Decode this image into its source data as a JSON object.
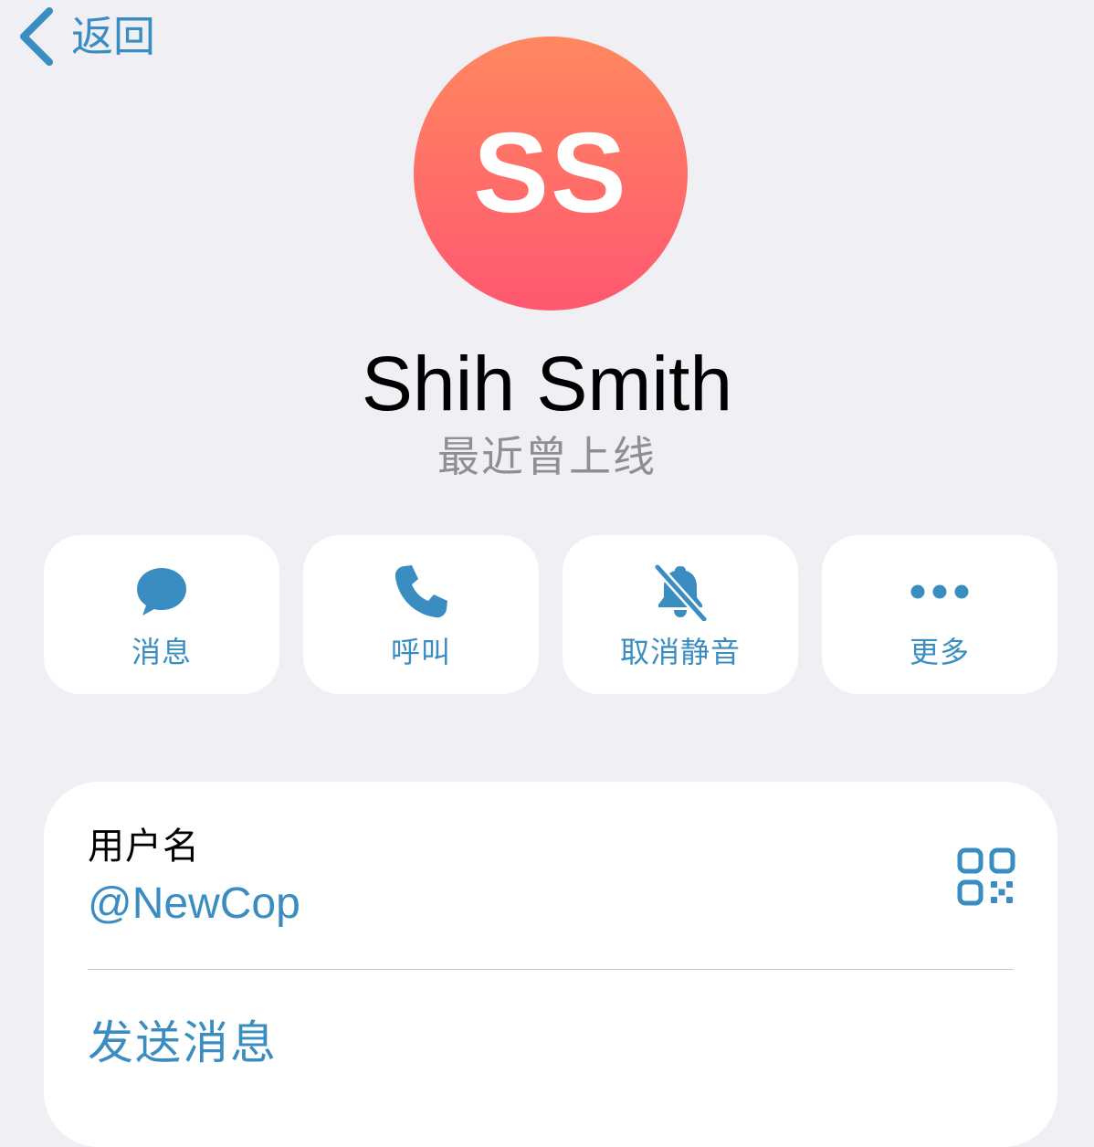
{
  "nav": {
    "back_label": "返回"
  },
  "profile": {
    "initials": "SS",
    "name": "Shih Smith",
    "status": "最近曾上线",
    "avatar_gradient": [
      "#ff875f",
      "#ff5870"
    ]
  },
  "actions": [
    {
      "label": "消息",
      "icon": "message-bubble-icon"
    },
    {
      "label": "呼叫",
      "icon": "phone-icon"
    },
    {
      "label": "取消静音",
      "icon": "bell-slash-icon"
    },
    {
      "label": "更多",
      "icon": "ellipsis-icon"
    }
  ],
  "info": {
    "username_label": "用户名",
    "username_value": "@NewCop",
    "qr_icon": "qr-code-icon",
    "send_message_label": "发送消息"
  },
  "colors": {
    "accent": "#3a8dc0",
    "background": "#efeff4",
    "card": "#ffffff",
    "secondary_text": "#8e8e93"
  }
}
